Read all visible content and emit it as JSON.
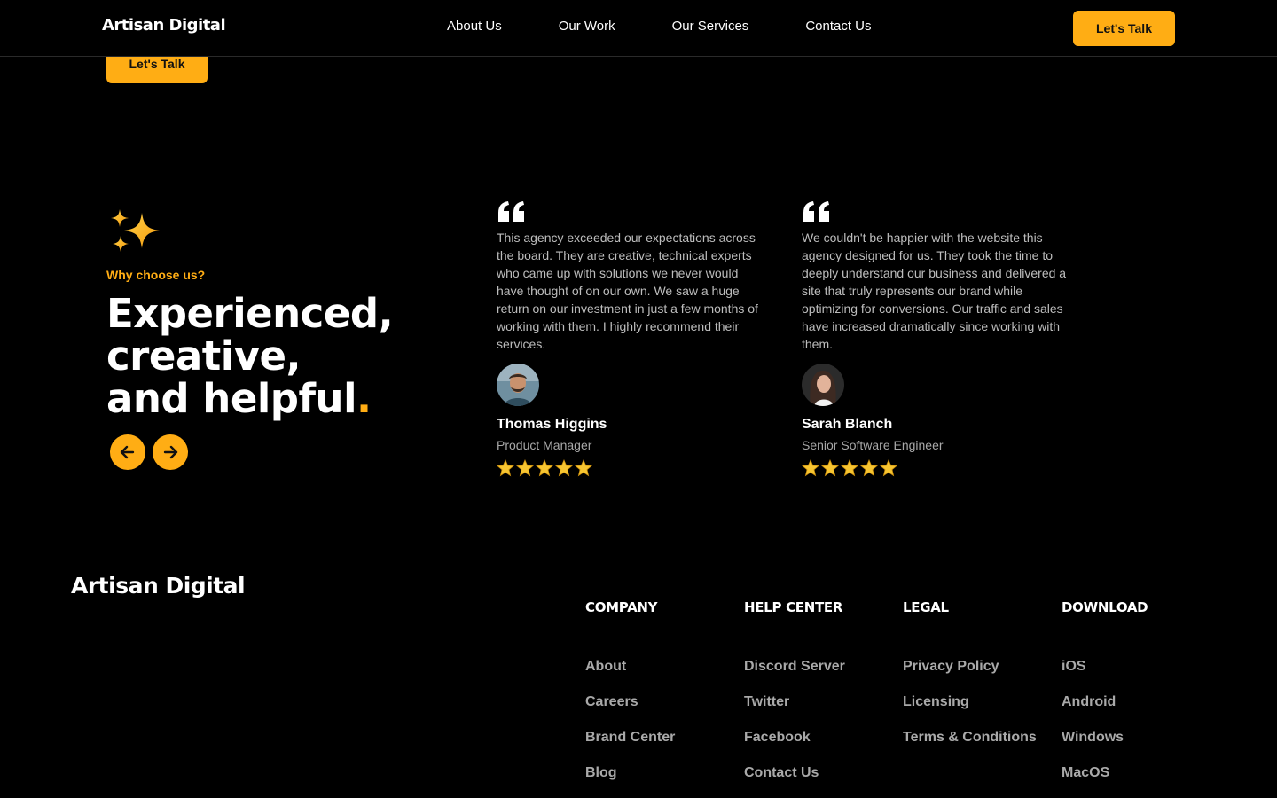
{
  "header": {
    "brand": "Artisan Digital",
    "nav": [
      "About Us",
      "Our Work",
      "Our Services",
      "Contact Us"
    ],
    "cta_label": "Let's Talk"
  },
  "hero_partial": {
    "cta_label": "Let's Talk"
  },
  "why": {
    "eyebrow": "Why choose us?",
    "headline_lines": [
      "Experienced,",
      "creative,",
      "and helpful"
    ],
    "headline_dot": ".",
    "accent_color": "#ffad14"
  },
  "testimonials": [
    {
      "text": "This agency exceeded our expectations across the board. They are creative, technical experts who came up with solutions we never would have thought of on our own. We saw a huge return on our investment in just a few months of working with them. I highly recommend their services.",
      "name": "Thomas Higgins",
      "role": "Product Manager",
      "rating": 5
    },
    {
      "text": "We couldn't be happier with the website this agency designed for us. They took the time to deeply understand our business and delivered a site that truly represents our brand while optimizing for conversions. Our traffic and sales have increased dramatically since working with them.",
      "name": "Sarah Blanch",
      "role": "Senior Software Engineer",
      "rating": 5
    }
  ],
  "footer": {
    "brand": "Artisan Digital",
    "columns": [
      {
        "title": "COMPANY",
        "links": [
          "About",
          "Careers",
          "Brand Center",
          "Blog"
        ]
      },
      {
        "title": "HELP CENTER",
        "links": [
          "Discord Server",
          "Twitter",
          "Facebook",
          "Contact Us"
        ]
      },
      {
        "title": "LEGAL",
        "links": [
          "Privacy Policy",
          "Licensing",
          "Terms & Conditions"
        ]
      },
      {
        "title": "DOWNLOAD",
        "links": [
          "iOS",
          "Android",
          "Windows",
          "MacOS"
        ]
      }
    ]
  }
}
